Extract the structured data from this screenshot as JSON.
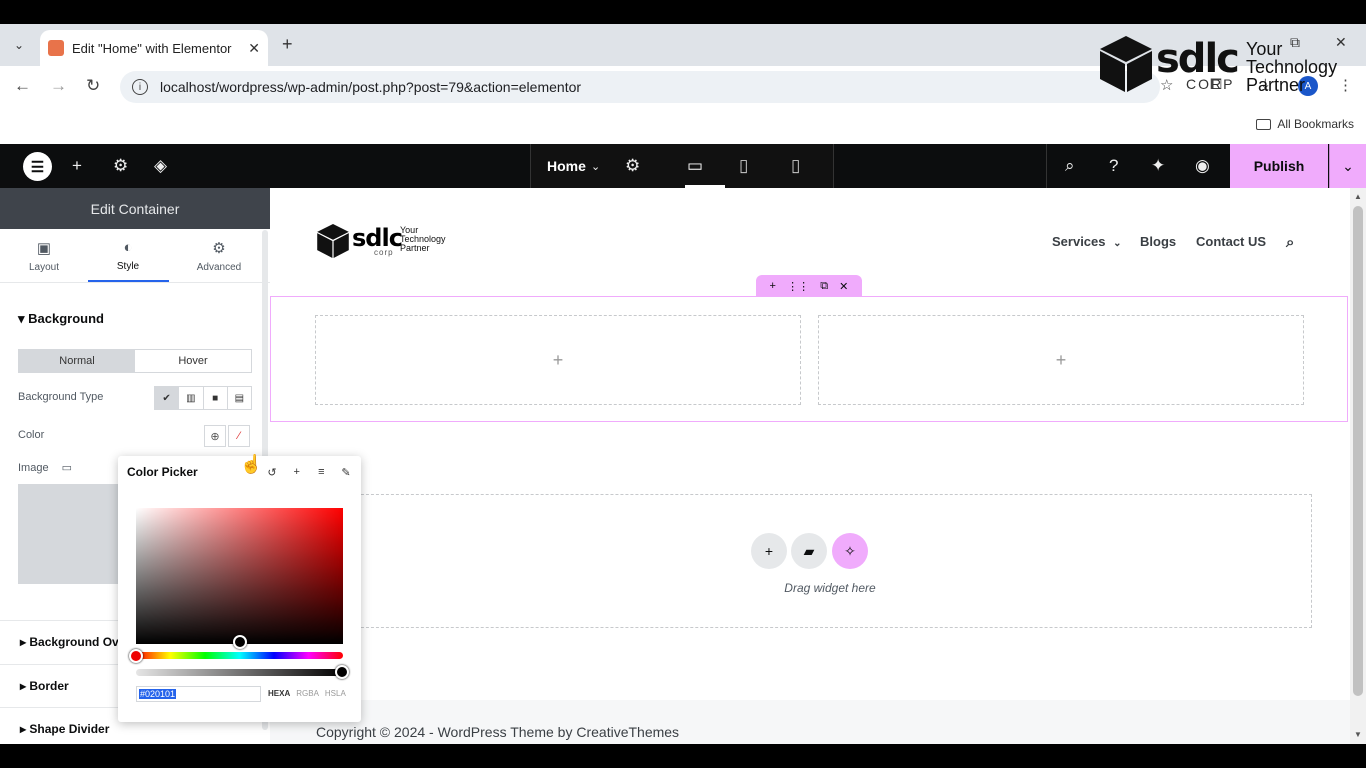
{
  "browser": {
    "tab_title": "Edit \"Home\" with Elementor",
    "url": "localhost/wordpress/wp-admin/post.php?post=79&action=elementor",
    "bookmarks_label": "All Bookmarks",
    "avatar_letter": "A"
  },
  "watermark": {
    "brand": "sdlc",
    "sub": "CORP",
    "tagline": "Your Technology Partner"
  },
  "editor_bar": {
    "page_name": "Home",
    "publish_label": "Publish"
  },
  "panel": {
    "header": "Edit Container",
    "tabs": [
      "Layout",
      "Style",
      "Advanced"
    ],
    "active_tab": "Style",
    "background_section": "Background",
    "state_tabs": [
      "Normal",
      "Hover"
    ],
    "background_type_label": "Background Type",
    "color_label": "Color",
    "image_label": "Image",
    "sections": [
      "Background Overlay",
      "Border",
      "Shape Divider"
    ]
  },
  "site": {
    "logo_text": "sdlc",
    "logo_sub": "corp",
    "logo_tagline": "Your Technology Partner",
    "menu": [
      "Services",
      "Blogs",
      "Contact US"
    ],
    "drag_text": "Drag widget here",
    "footer": "Copyright © 2024 - WordPress Theme by CreativeThemes"
  },
  "color_picker": {
    "title": "Color Picker",
    "hex_value": "#020101",
    "modes": [
      "HEXA",
      "RGBA",
      "HSLA"
    ],
    "active_mode": "HEXA"
  },
  "colors": {
    "accent": "#f0abfc",
    "editor_bar": "#0c0d0e",
    "panel_header": "#3f444b",
    "selected_color": "#020101"
  }
}
